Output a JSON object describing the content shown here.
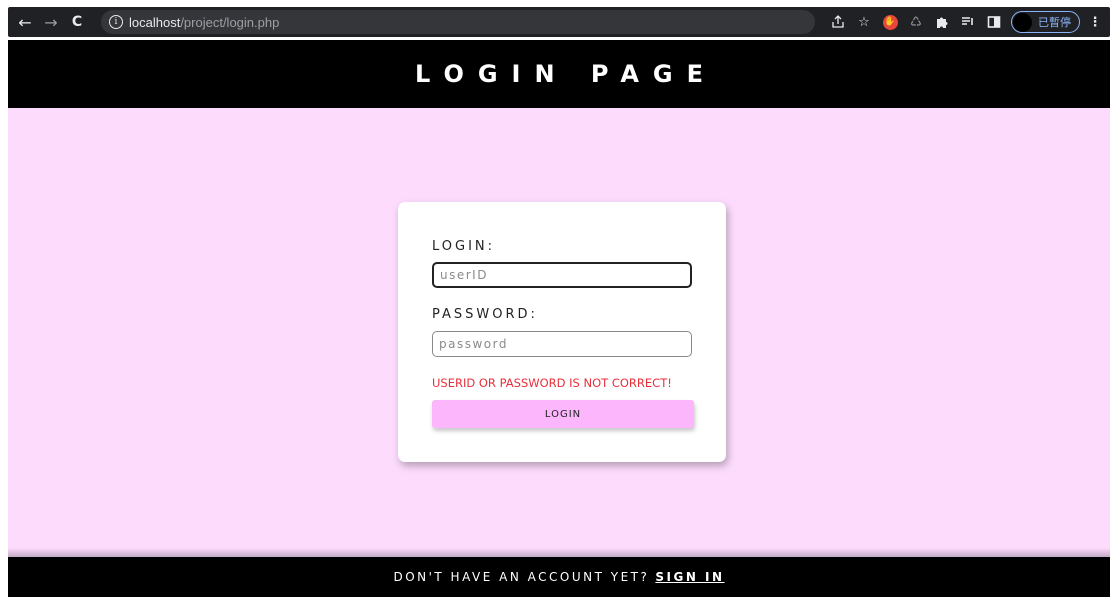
{
  "browser": {
    "back_icon": "←",
    "forward_icon": "→",
    "reload_icon": "C",
    "url_host": "localhost",
    "url_path": "/project/login.php",
    "profile_label": "已暫停",
    "accent_color": "#8ab4f8"
  },
  "header": {
    "title": "LOGIN PAGE"
  },
  "form": {
    "login_label": "LOGIN:",
    "userid_placeholder": "userID",
    "password_label": "PASSWORD:",
    "password_placeholder": "password",
    "error_message": "USERID OR PASSWORD IS NOT CORRECT!",
    "error_color": "#e8303a",
    "submit_label": "LOGIN"
  },
  "footer": {
    "prompt": "DON'T HAVE AN ACCOUNT YET?",
    "link_label": "SIGN IN"
  },
  "colors": {
    "page_bg": "#fcdbfc",
    "bar_bg": "#000000",
    "button_bg": "#fcb6fc"
  }
}
